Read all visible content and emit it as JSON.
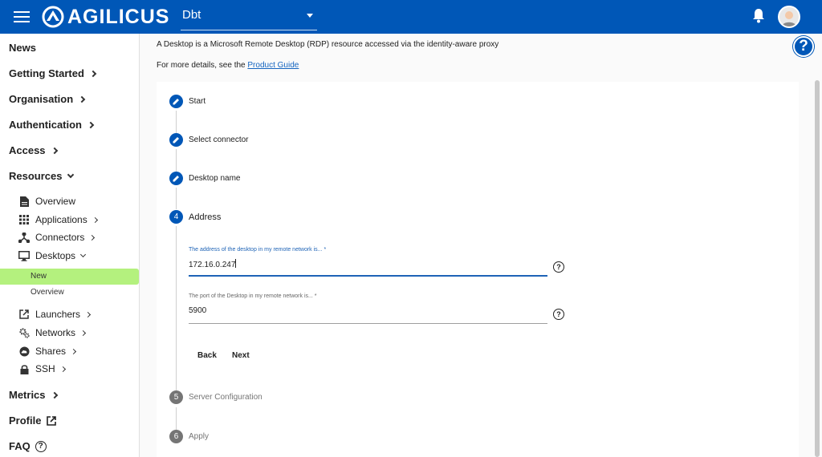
{
  "header": {
    "logo_text": "AGILICUS",
    "org_selector": "Dbt"
  },
  "sidebar": {
    "news": "News",
    "getting_started": "Getting Started",
    "organisation": "Organisation",
    "authentication": "Authentication",
    "access": "Access",
    "resources": "Resources",
    "resources_children": {
      "overview": "Overview",
      "applications": "Applications",
      "connectors": "Connectors",
      "desktops": "Desktops",
      "desktops_children": {
        "new": "New",
        "overview": "Overview"
      },
      "launchers": "Launchers",
      "networks": "Networks",
      "shares": "Shares",
      "ssh": "SSH"
    },
    "metrics": "Metrics",
    "profile": "Profile",
    "faq": "FAQ"
  },
  "main": {
    "intro_text": "A Desktop is a Microsoft Remote Desktop (RDP) resource accessed via the identity-aware proxy",
    "details_prefix": "For more details, see the ",
    "details_link": "Product Guide",
    "help_label": "?",
    "steps": [
      {
        "label": "Start",
        "state": "done"
      },
      {
        "label": "Select connector",
        "state": "done"
      },
      {
        "label": "Desktop name",
        "state": "done"
      },
      {
        "number": "4",
        "label": "Address",
        "state": "active"
      },
      {
        "number": "5",
        "label": "Server Configuration",
        "state": "pending"
      },
      {
        "number": "6",
        "label": "Apply",
        "state": "pending"
      }
    ],
    "address_field": {
      "label": "The address of the desktop in my remote network is... *",
      "value": "172.16.0.247"
    },
    "port_field": {
      "label": "The port of the Desktop in my remote network is... *",
      "value": "5900"
    },
    "field_help": "?",
    "back_label": "Back",
    "next_label": "Next"
  },
  "colors": {
    "primary": "#0057b7",
    "active_nav": "#b4f17e",
    "link": "#1565c0"
  }
}
